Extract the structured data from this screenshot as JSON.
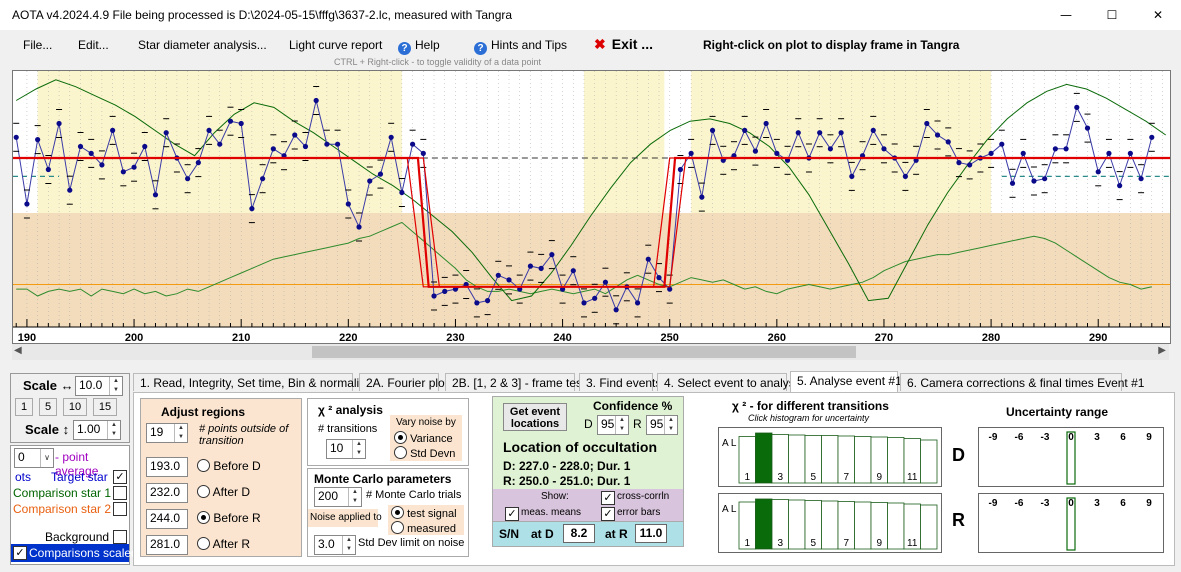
{
  "title": "AOTA v4.2024.4.9    File being processed is D:\\2024-05-15\\fffg\\3637-2.lc, measured with Tangra",
  "menu": {
    "file": "File...",
    "edit": "Edit...",
    "star_diameter": "Star diameter analysis...",
    "light_curve": "Light curve report",
    "help": "Help",
    "hints": "Hints and Tips",
    "exit": "Exit ...",
    "right_click_note": "Right-click on plot to display frame in Tangra"
  },
  "ctrl_hint": "CTRL + Right-click  -  to toggle validity of a data point",
  "chart_data": {
    "type": "line",
    "xlim": [
      188.7,
      296.7
    ],
    "ylim": [
      0,
      1
    ],
    "x_ticks": [
      190,
      200,
      210,
      220,
      230,
      240,
      250,
      260,
      270,
      280,
      290
    ],
    "tick_labels": [
      "190",
      "200",
      "210",
      "220",
      "230",
      "240",
      "250",
      "260",
      "270",
      "280",
      "290"
    ],
    "event": {
      "D": 227.5,
      "R": 250.5
    },
    "model": {
      "high": 0.7,
      "low": 0.14
    },
    "series_light_curve": [
      0.79,
      0.5,
      0.78,
      0.65,
      0.85,
      0.56,
      0.75,
      0.72,
      0.67,
      0.82,
      0.64,
      0.66,
      0.75,
      0.54,
      0.81,
      0.7,
      0.61,
      0.68,
      0.82,
      0.76,
      0.86,
      0.85,
      0.48,
      0.61,
      0.74,
      0.71,
      0.8,
      0.75,
      0.95,
      0.76,
      0.76,
      0.5,
      0.4,
      0.6,
      0.63,
      0.79,
      0.55,
      0.76,
      0.72,
      0.66,
      0.68,
      0.69,
      0.71,
      0.63,
      0.64,
      0.75,
      0.73,
      0.69,
      0.79,
      0.78,
      0.84,
      0.69,
      0.77,
      0.63,
      0.65,
      0.72,
      0.6,
      0.7,
      0.63,
      0.82,
      0.74,
      0.69,
      0.65,
      0.72,
      0.53,
      0.82,
      0.69,
      0.71,
      0.82,
      0.73,
      0.85,
      0.72,
      0.69,
      0.81,
      0.7,
      0.81,
      0.74,
      0.81,
      0.62,
      0.71,
      0.82,
      0.74,
      0.7,
      0.62,
      0.69,
      0.85,
      0.8,
      0.77,
      0.68,
      0.67,
      0.7,
      0.72,
      0.76,
      0.59,
      0.72,
      0.6,
      0.61,
      0.74,
      0.74,
      0.92,
      0.83,
      0.64,
      0.72,
      0.58,
      0.72,
      0.61,
      0.79
    ],
    "series_comparison": [
      0.13,
      0.13,
      0.1,
      0.12,
      0.13,
      0.12,
      0.13,
      0.1,
      0.13,
      0.12,
      0.11,
      0.13,
      0.11,
      0.12,
      0.1,
      0.11,
      0.13,
      0.12,
      0.14,
      0.16,
      0.18,
      0.2,
      0.22,
      0.24,
      0.26,
      0.27,
      0.28,
      0.29,
      0.3,
      0.31,
      0.32,
      0.33,
      0.35,
      0.36,
      0.38,
      0.4,
      0.42,
      0.38,
      0.34,
      0.3,
      0.26,
      0.22,
      0.17,
      0.14,
      0.12,
      0.12,
      0.13,
      0.12,
      0.11,
      0.12,
      0.13,
      0.12,
      0.11,
      0.12,
      0.13,
      0.11,
      0.14,
      0.17,
      0.19,
      0.17,
      0.15,
      0.14,
      0.16,
      0.18,
      0.17,
      0.16,
      0.17,
      0.15,
      0.13,
      0.14,
      0.12,
      0.11,
      0.13,
      0.14,
      0.15,
      0.14,
      0.13,
      0.14,
      0.15,
      0.16,
      0.18,
      0.21,
      0.23,
      0.25,
      0.26,
      0.27,
      0.28,
      0.28,
      0.29,
      0.3,
      0.31,
      0.32,
      0.33,
      0.34,
      0.35,
      0.36,
      0.35,
      0.33,
      0.3,
      0.27,
      0.24,
      0.21,
      0.18,
      0.16,
      0.15,
      0.13,
      0.14
    ],
    "series_correlation": [
      0.95,
      1.0,
      1.04,
      1.01,
      0.97,
      0.93,
      0.88,
      0.82,
      0.76,
      0.71,
      0.81,
      0.89,
      0.94,
      0.92,
      0.86,
      0.81,
      0.75,
      0.69,
      0.63,
      0.58,
      0.52,
      0.45,
      0.38,
      0.29,
      0.18,
      0.08,
      0.1,
      0.2,
      0.32,
      0.45,
      0.57,
      0.68,
      0.76,
      0.82,
      0.86,
      0.87,
      0.85,
      0.81,
      0.75,
      0.66,
      0.54,
      0.39,
      0.24,
      0.08,
      0.09,
      0.25,
      0.41,
      0.55,
      0.67,
      0.78,
      0.87,
      0.94,
      0.99,
      1.02,
      1.0,
      0.96,
      0.91,
      0.86,
      0.8
    ]
  },
  "left_panel": {
    "scale_h_label": "Scale ↔",
    "scale_h_value": "10.0",
    "scale_presets": [
      "1",
      "5",
      "10",
      "15"
    ],
    "scale_v_label": "Scale ↕",
    "scale_v_value": "1.00",
    "point_avg_value": "0",
    "point_avg_label": "- point average",
    "pts_label": "ots",
    "target_label": "Target star",
    "comp1_label": "Comparison star 1",
    "comp2_label": "Comparison star 2",
    "background_label": "Background",
    "comparisons_scaled_label": "Comparisons scaled",
    "colors": {
      "target": "#0000cc",
      "comp1": "#006400",
      "comp2": "#e86010"
    }
  },
  "tabs": [
    "1.  Read, Integrity, Set time, Bin & normalise",
    "2A. Fourier plot",
    "2B. [1, 2 & 3] - frame test",
    "3. Find events",
    "4. Select event to analyse",
    "5. Analyse event #1",
    "6. Camera corrections & final times Event #1"
  ],
  "active_tab": 5,
  "adjust": {
    "title": "Adjust regions",
    "points_value": "19",
    "points_label": "# points outside of transition",
    "before_d_value": "193.0",
    "before_d_label": "Before D",
    "after_d_value": "232.0",
    "after_d_label": "After D",
    "before_r_value": "244.0",
    "before_r_label": "Before R",
    "after_r_value": "281.0",
    "after_r_label": "After R"
  },
  "chi": {
    "title": "χ ² analysis",
    "transitions_label": "# transitions",
    "transitions_value": "10",
    "vary_label": "Vary noise by",
    "variance_label": "Variance",
    "stddev_label": "Std Devn"
  },
  "mc": {
    "title": "Monte Carlo parameters",
    "trials_value": "200",
    "trials_label": "# Monte Carlo trials",
    "noise_applied_label": "Noise applied to",
    "test_signal_label": "test signal",
    "measured_label": "measured",
    "std_limit_value": "3.0",
    "std_limit_label": "Std Dev limit on noise"
  },
  "event": {
    "get_locations_label": "Get event locations",
    "confidence_label": "Confidence %",
    "d_label": "D",
    "d_conf": "95",
    "r_label": "R",
    "r_conf": "95",
    "location_title": "Location of occultation",
    "d_line": "D: 227.0 - 228.0; Dur. 1",
    "r_line": "R: 250.0 - 251.0; Dur. 1",
    "show_label": "Show:",
    "cross_corr_label": "cross-corrln",
    "meas_means_label": "meas. means",
    "error_bars_label": "error bars",
    "sn_label": "S/N",
    "at_d_label": "at D",
    "sn_d": "8.2",
    "at_r_label": "at R",
    "sn_r": "11.0"
  },
  "chi_hist": {
    "title": "χ ² - for different transitions",
    "subtitle": "Click histogram for uncertainty",
    "all_label": "A L L",
    "x_labels": [
      "1",
      "3",
      "5",
      "7",
      "9",
      "11"
    ],
    "d_label": "D",
    "r_label": "R",
    "d_bars": [
      0.93,
      1.0,
      0.97,
      0.96,
      0.95,
      0.95,
      0.94,
      0.93,
      0.92,
      0.91,
      0.89,
      0.86
    ],
    "r_bars": [
      0.94,
      1.0,
      0.99,
      0.98,
      0.97,
      0.96,
      0.95,
      0.94,
      0.93,
      0.92,
      0.9,
      0.88
    ],
    "selected_index": 1
  },
  "uncertainty": {
    "title": "Uncertainty range",
    "labels": [
      "-9",
      "-6",
      "-3",
      "0",
      "3",
      "6",
      "9"
    ]
  }
}
